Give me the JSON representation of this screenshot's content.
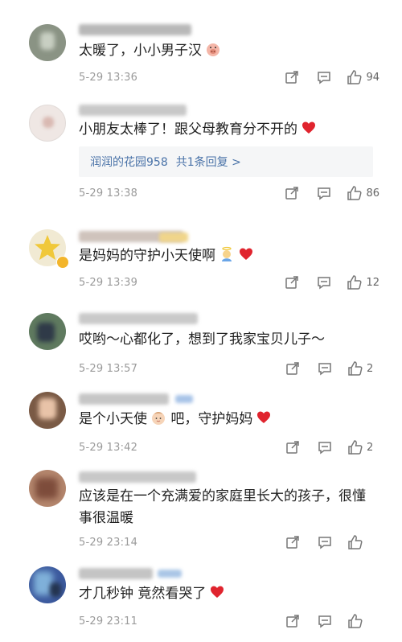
{
  "comments": [
    {
      "text": "太暖了，小小男子汉",
      "emoji_name": "pig-face-emoji",
      "time": "5-29 13:36",
      "likes": "94"
    },
    {
      "text": "小朋友太棒了！跟父母教育分不开的",
      "emoji_name": "red-heart-emoji",
      "time": "5-29 13:38",
      "likes": "86",
      "reply": {
        "name": "润润的花园958",
        "summary": "共1条回复 >"
      }
    },
    {
      "text": "是妈妈的守护小天使啊",
      "emoji_name": "angel-red-heart-emoji",
      "time": "5-29 13:39",
      "likes": "12"
    },
    {
      "text": "哎哟～心都化了，想到了我家宝贝儿子～",
      "time": "5-29 13:57",
      "likes": "2"
    },
    {
      "text": "是个小天使",
      "text_after": " 吧，守护妈妈",
      "emoji_name": "baby-face-red-heart-emoji",
      "time": "5-29 13:42",
      "likes": "2"
    },
    {
      "text": "应该是在一个充满爱的家庭里长大的孩子，很懂事很温暖",
      "time": "5-29 23:14",
      "likes": ""
    },
    {
      "text": "才几秒钟 竟然看哭了",
      "emoji_name": "red-heart-emoji",
      "time": "5-29 23:11",
      "likes": ""
    }
  ],
  "colors": {
    "accent_link": "#4a73a8",
    "heart": "#e0242e",
    "meta_text": "#9a9a9a"
  }
}
